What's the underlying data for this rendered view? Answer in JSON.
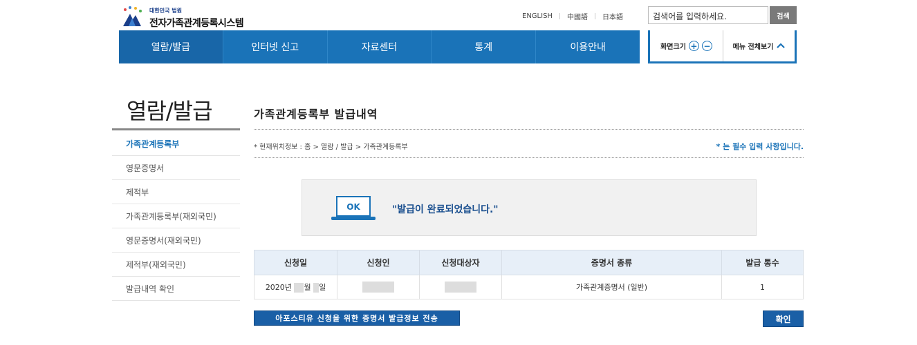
{
  "header": {
    "logo_sub": "대한민국 법원",
    "logo_main": "전자가족관계등록시스템",
    "languages": [
      "ENGLISH",
      "中國語",
      "日本語"
    ],
    "search_placeholder": "검색어를 입력하세요.",
    "search_button": "검색"
  },
  "nav": {
    "items": [
      "열람/발급",
      "인터넷 신고",
      "자료센터",
      "통계",
      "이용안내"
    ]
  },
  "util": {
    "zoom_label": "화면크기",
    "zoom_in": "+",
    "zoom_out": "−",
    "menu_all": "메뉴 전체보기"
  },
  "sidebar": {
    "title": "열람/발급",
    "items": [
      "가족관계등록부",
      "영문증명서",
      "제적부",
      "가족관계등록부(재외국민)",
      "영문증명서(재외국민)",
      "제적부(재외국민)",
      "발급내역 확인"
    ]
  },
  "main": {
    "title": "가족관계등록부 발급내역",
    "breadcrumb": "* 현재위치정보 : 홈 > 열람 / 발급 > 가족관계등록부",
    "required_note": "* 는 필수 입력 사항입니다.",
    "ok_label": "OK",
    "done_message": "\"발급이 완료되었습니다.\""
  },
  "table": {
    "headers": [
      "신청일",
      "신청인",
      "신청대상자",
      "증명서 종류",
      "발급 통수"
    ],
    "row": {
      "date_year": "2020년",
      "date_month": "월",
      "date_day": "일",
      "cert_type": "가족관계증명서 (일반)",
      "count": "1"
    }
  },
  "buttons": {
    "send": "아포스티유 신청을 위한 증명서 발급정보 전송",
    "confirm": "확인"
  },
  "colors": {
    "nav_blue": "#1a73b8",
    "button_blue": "#1a5fa6",
    "table_header": "#e7eff8"
  }
}
